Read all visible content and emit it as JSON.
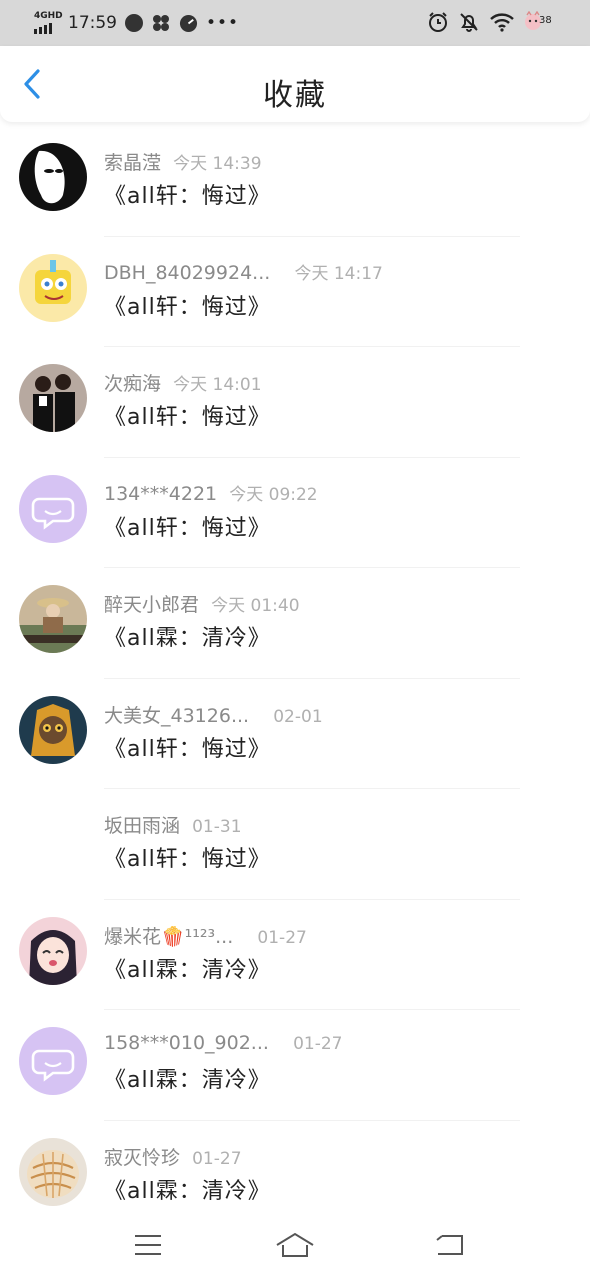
{
  "status_bar": {
    "network": "4GHD",
    "time": "17:59",
    "battery": "38"
  },
  "header": {
    "title": "收藏"
  },
  "items": [
    {
      "name": "索晶滢",
      "time": "今天 14:39",
      "title": "《all轩：悔过》"
    },
    {
      "name": "DBH_84029924...",
      "time": "今天 14:17",
      "title": "《all轩：悔过》"
    },
    {
      "name": "次痴海",
      "time": "今天 14:01",
      "title": "《all轩：悔过》"
    },
    {
      "name": "134***4221",
      "time": "今天 09:22",
      "title": "《all轩：悔过》"
    },
    {
      "name": "醉天小郎君",
      "time": "今天 01:40",
      "title": "《all霖：清冷》"
    },
    {
      "name": "大美女_43126...",
      "time": "02-01",
      "title": "《all轩：悔过》"
    },
    {
      "name": "坂田雨涵",
      "time": "01-31",
      "title": "《all轩：悔过》"
    },
    {
      "name": "爆米花🍿¹¹²³...",
      "time": "01-27",
      "title": "《all霖：清冷》"
    },
    {
      "name": "158***010_902...",
      "time": "01-27",
      "title": "《all霖：清冷》"
    },
    {
      "name": "寂灭怜珍",
      "time": "01-27",
      "title": "《all霖：清冷》"
    }
  ],
  "colors": {
    "accent": "#2d8fe6",
    "default_avatar": "#d6c3f3",
    "status_bar_bg": "#d8d8d8"
  }
}
